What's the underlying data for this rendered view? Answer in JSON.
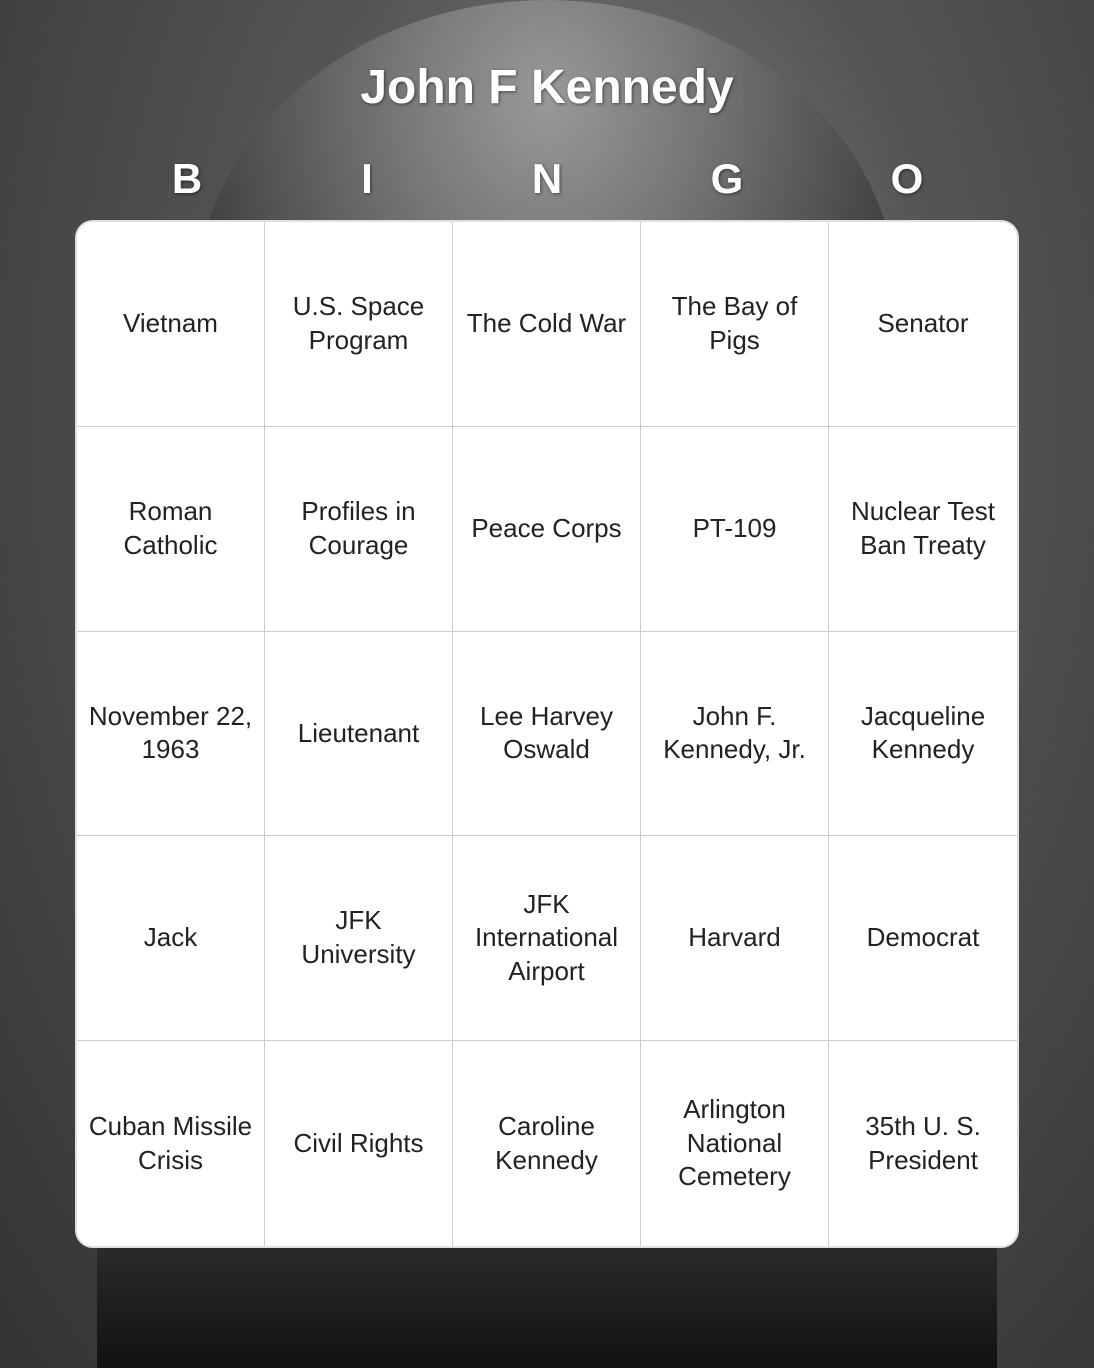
{
  "page": {
    "title": "John F Kennedy",
    "background_description": "black and white photo of JFK"
  },
  "bingo": {
    "letters": [
      "B",
      "I",
      "N",
      "G",
      "O"
    ],
    "cells": [
      "Vietnam",
      "U.S. Space Program",
      "The Cold War",
      "The Bay of Pigs",
      "Senator",
      "Roman Catholic",
      "Profiles in Courage",
      "Peace Corps",
      "PT-109",
      "Nuclear Test Ban Treaty",
      "November 22, 1963",
      "Lieutenant",
      "Lee Harvey Oswald",
      "John F. Kennedy, Jr.",
      "Jacqueline Kennedy",
      "Jack",
      "JFK University",
      "JFK International Airport",
      "Harvard",
      "Democrat",
      "Cuban Missile Crisis",
      "Civil Rights",
      "Caroline Kennedy",
      "Arlington National Cemetery",
      "35th U. S. President"
    ]
  }
}
